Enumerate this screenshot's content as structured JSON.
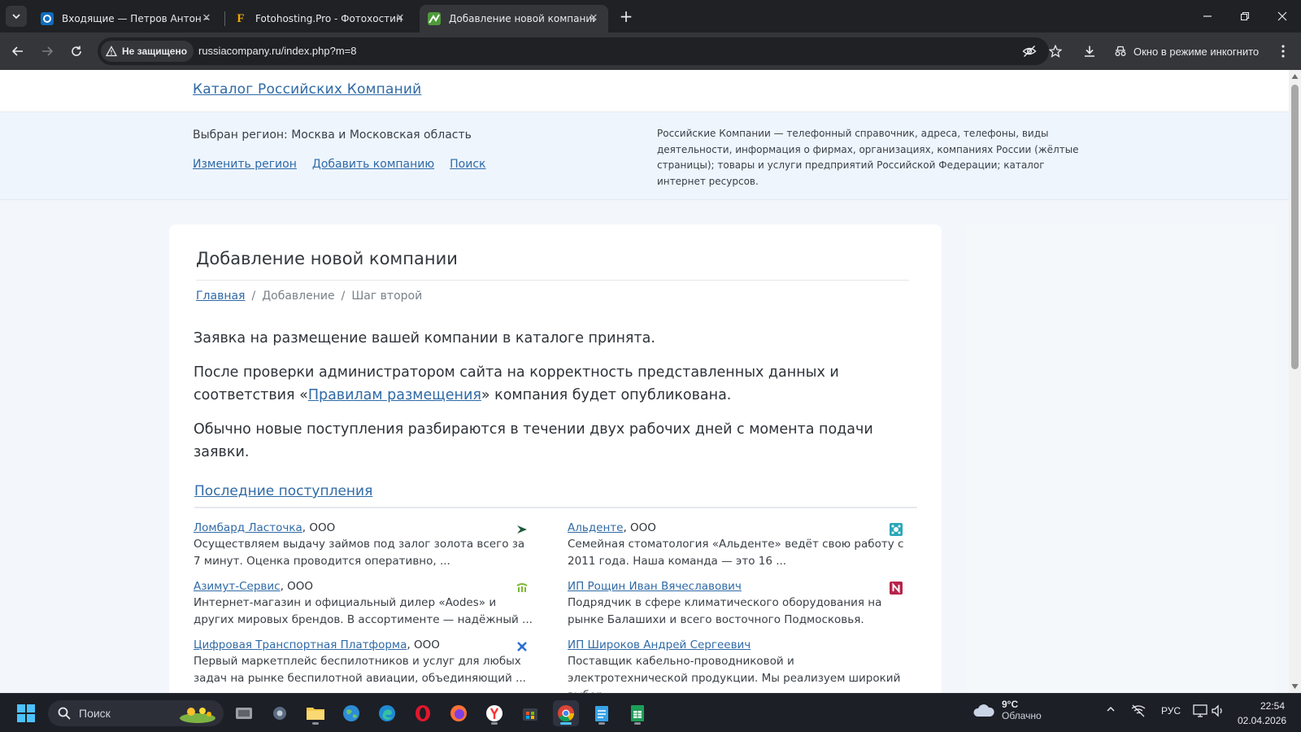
{
  "browser": {
    "tabs": [
      {
        "title": "Входящие — Петров Антон —",
        "icon": "outlook-icon",
        "active": false
      },
      {
        "title": "Fotohosting.Pro - Фотохостинг",
        "icon": "fotohosting-f-icon",
        "active": false
      },
      {
        "title": "Добавление новой компании",
        "icon": "site-favicon",
        "active": true
      }
    ],
    "security_label": "Не защищено",
    "url": "russiacompany.ru/index.php?m=8",
    "incognito_label": "Окно в режиме инкогнито"
  },
  "site": {
    "brand": "Каталог Российских Компаний",
    "region_label": "Выбран регион: Москва и Московская область",
    "links": {
      "change_region": "Изменить регион",
      "add_company": "Добавить компанию",
      "search": "Поиск"
    },
    "description": "Российские Компании — телефонный справочник, адреса, телефоны, виды деятельности, информация о фирмах, организациях, компаниях России (жёлтые страницы); товары и услуги предприятий Российской Федерации; каталог интернет ресурсов."
  },
  "main": {
    "title": "Добавление новой компании",
    "breadcrumb": {
      "home": "Главная",
      "sep": "/",
      "step1": "Добавление",
      "step2": "Шаг второй"
    },
    "message1": "Заявка на размещение вашей компании в каталоге принята.",
    "message2_before": "После проверки администратором сайта на корректность представленных данных и соответствия «",
    "message2_link": "Правилам размещения",
    "message2_after": "» компания будет опубликована.",
    "message3": "Обычно новые поступления разбираются в течении двух рабочих дней с момента подачи заявки.",
    "recent_heading": "Последние поступления",
    "recent": [
      {
        "name": "Ломбард Ласточка",
        "suffix": ", ООО",
        "desc": "Осуществляем выдачу займов под залог золота всего за 7 минут. Оценка проводится оперативно, ...",
        "logo": "swallow-logo-icon"
      },
      {
        "name": "Альденте",
        "suffix": ", ООО",
        "desc": "Семейная стоматология «Альденте» ведёт свою работу с 2011 года. Наша команда — это 16 ...",
        "logo": "aldente-logo-icon"
      },
      {
        "name": "Азимут-Сервис",
        "suffix": ", ООО",
        "desc": "Интернет-магазин и официальный дилер «Aodes» и других мировых брендов. В ассортименте — надёжный ...",
        "logo": "azimut-logo-icon"
      },
      {
        "name": "ИП Рощин Иван Вячеславович",
        "suffix": "",
        "desc": "Подрядчик в сфере климатического оборудования на рынке Балашихи и всего восточного Подмосковья.",
        "logo": "n-logo-icon"
      },
      {
        "name": "Цифровая Транспортная Платформа",
        "suffix": ", ООО",
        "desc": "Первый маркетплейс беспилотников и услуг для любых задач на рынке беспилотной авиации, объединяющий ...",
        "logo": "drone-logo-icon"
      },
      {
        "name": "ИП Широков Андрей Сергеевич",
        "suffix": "",
        "desc": "Поставщик кабельно-проводниковой и электротехнической продукции. Мы реализуем широкий выбор ...",
        "logo": ""
      }
    ]
  },
  "taskbar": {
    "search_placeholder": "Поиск",
    "weather_temp": "9°C",
    "weather_desc": "Облачно",
    "lang": "РУС",
    "time": "22:54",
    "date": "02.04.2026"
  }
}
